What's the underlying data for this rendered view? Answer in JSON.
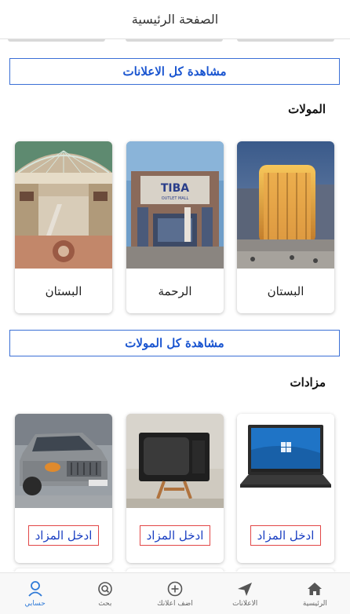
{
  "header": {
    "title": "الصفحة الرئيسية"
  },
  "ads_see_all": "مشاهدة كل الاعلانات",
  "malls": {
    "title": "المولات",
    "items": [
      {
        "label": "البستان",
        "image": "mall-night-image"
      },
      {
        "label": "الرحمة",
        "image": "tiba-outlet-mall-image"
      },
      {
        "label": "البستان",
        "image": "mall-atrium-image"
      }
    ],
    "see_all": "مشاهدة كل المولات"
  },
  "auctions": {
    "title": "مزادات",
    "items": [
      {
        "image": "laptop-image",
        "button": "ادخل المزاد"
      },
      {
        "image": "crt-tv-image",
        "button": "ادخل المزاد"
      },
      {
        "image": "car-image",
        "button": "ادخل المزاد"
      }
    ]
  },
  "bottom_nav": {
    "items": [
      {
        "label": "حسابي",
        "icon": "person-icon",
        "active": true
      },
      {
        "label": "بحث",
        "icon": "search-icon",
        "active": false
      },
      {
        "label": "اضف اعلانك",
        "icon": "plus-circle-icon",
        "active": false
      },
      {
        "label": "الاعلانات",
        "icon": "paper-plane-icon",
        "active": false
      },
      {
        "label": "الرئيسية",
        "icon": "home-icon",
        "active": false
      }
    ]
  },
  "colors": {
    "accent": "#1a55d0",
    "nav_active": "#2f7ad7",
    "auction_border": "#e24747"
  }
}
